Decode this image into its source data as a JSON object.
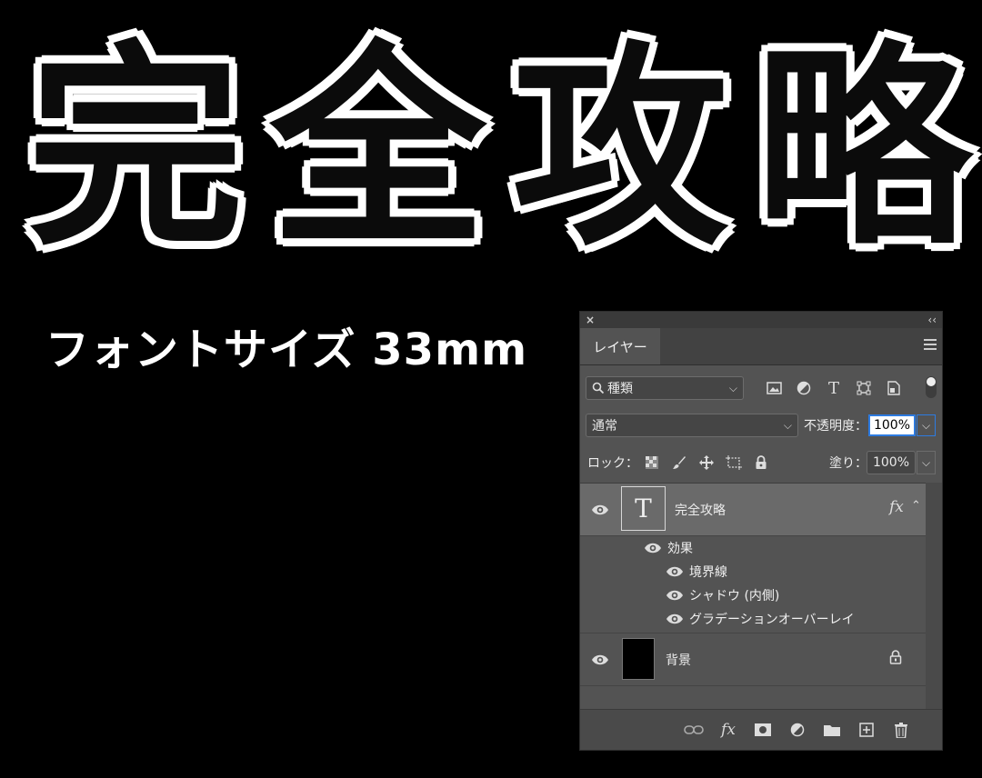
{
  "headline": {
    "text": "完全攻略",
    "chars": [
      "完",
      "全",
      "攻",
      "略"
    ]
  },
  "subtitle": "フォントサイズ 33mm",
  "panel": {
    "close_symbol": "×",
    "collapse_symbol": "‹‹",
    "tab_label": "レイヤー",
    "filter": {
      "label": "種類"
    },
    "blend_mode": "通常",
    "opacity_label": "不透明度：",
    "opacity_value": "100%",
    "lock_label": "ロック：",
    "fill_label": "塗り：",
    "fill_value": "100%",
    "layers": [
      {
        "name": "完全攻略",
        "type": "text",
        "thumb_glyph": "T",
        "fx": "fx",
        "effects_label": "効果",
        "effects": [
          "境界線",
          "シャドウ (内側)",
          "グラデーションオーバーレイ"
        ]
      },
      {
        "name": "背景",
        "type": "background"
      }
    ],
    "bottom_icons": [
      "link-icon",
      "fx-icon",
      "mask-icon",
      "adjustment-icon",
      "folder-icon",
      "new-layer-icon",
      "trash-icon"
    ],
    "bottom_fx": "fx"
  },
  "colors": {
    "background": "#000000",
    "panel": "#535353",
    "selected_layer": "#6a6a6a",
    "accent": "#2d7be0"
  }
}
